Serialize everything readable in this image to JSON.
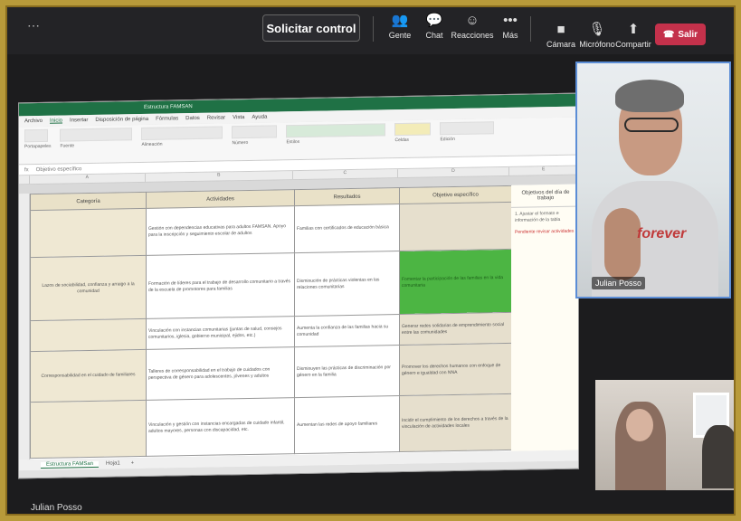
{
  "toolbar": {
    "request_control": "Solicitar control",
    "items": [
      {
        "label": "Gente",
        "icon": "people-icon"
      },
      {
        "label": "Chat",
        "icon": "chat-icon"
      },
      {
        "label": "Reacciones",
        "icon": "reactions-icon"
      },
      {
        "label": "Más",
        "icon": "more-icon"
      },
      {
        "label": "Cámara",
        "icon": "camera-icon"
      },
      {
        "label": "Micrófono",
        "icon": "microphone-icon"
      },
      {
        "label": "Compartir",
        "icon": "share-icon"
      }
    ],
    "leave": "Salir"
  },
  "excel": {
    "title": "Estructura FAMSAN",
    "menu": [
      "Archivo",
      "Inicio",
      "Insertar",
      "Disposición de página",
      "Fórmulas",
      "Datos",
      "Revisar",
      "Vista",
      "Ayuda"
    ],
    "ribbon_groups": [
      "Portapapeles",
      "Fuente",
      "Alineación",
      "Número",
      "Estilos",
      "Celdas",
      "Edición"
    ],
    "formula_bar": "Objetivo específico",
    "headers": [
      "Categoría",
      "Actividades",
      "Resultados",
      "Objetivo específico"
    ],
    "rows": [
      {
        "category": "",
        "activities": "Gestión con dependencias educativas para adultos FAMSAN. Apoyo para la inscripción y seguimiento escolar de adultos",
        "results": "Familias con certificados de educación básica",
        "objective": "",
        "highlight": "tan"
      },
      {
        "category": "Lazos de sociabilidad, confianza y arraigo a la comunidad",
        "activities": "Formación de líderes para el trabajo de desarrollo comunitario a través de la escuela de promotores para familias",
        "results": "Disminución de prácticas violentas en las relaciones comunitarias",
        "objective": "Fomentar la participación de las familias en la vida comunitaria",
        "highlight": "green"
      },
      {
        "category": "",
        "activities": "Vinculación con instancias comunitarias (juntas de salud, consejos comunitarios, iglesia, gobierno municipal, ejidos, etc.)",
        "results": "Aumenta la confianza de las familias hacia su comunidad",
        "objective": "Generar redes solidarias de emprendimiento social entre las comunidades",
        "highlight": "tan"
      },
      {
        "category": "Corresponsabilidad en el cuidado de familiares",
        "activities": "Talleres de corresponsabilidad en el trabajo de cuidados con perspectiva de género para adolescentes, jóvenes y adultos",
        "results": "Disminuyen las prácticas de discriminación por género en la familia",
        "objective": "Promover los derechos humanos con enfoque de género e igualdad con NNA",
        "highlight": "tan"
      },
      {
        "category": "",
        "activities": "Vinculación y gestión con instancias encargadas de cuidado infantil, adultos mayores, personas con discapacidad, etc.",
        "results": "Aumentan las redes de apoyo familiares",
        "objective": "Incidir el cumplimiento de los derechos a través de la vinculación de actividades locales",
        "highlight": "tan"
      }
    ],
    "side_header": "Objetivos del día de trabajo",
    "side_body": "1. Ajustar el formato e información de la tabla",
    "side_red": "Pendiente revisar actividades",
    "tabs": [
      "Estructura FAMSan",
      "Hoja1"
    ]
  },
  "participants": {
    "main_name": "Julian Posso",
    "shirt_text": "forever",
    "footer_name": "Julian Posso"
  }
}
